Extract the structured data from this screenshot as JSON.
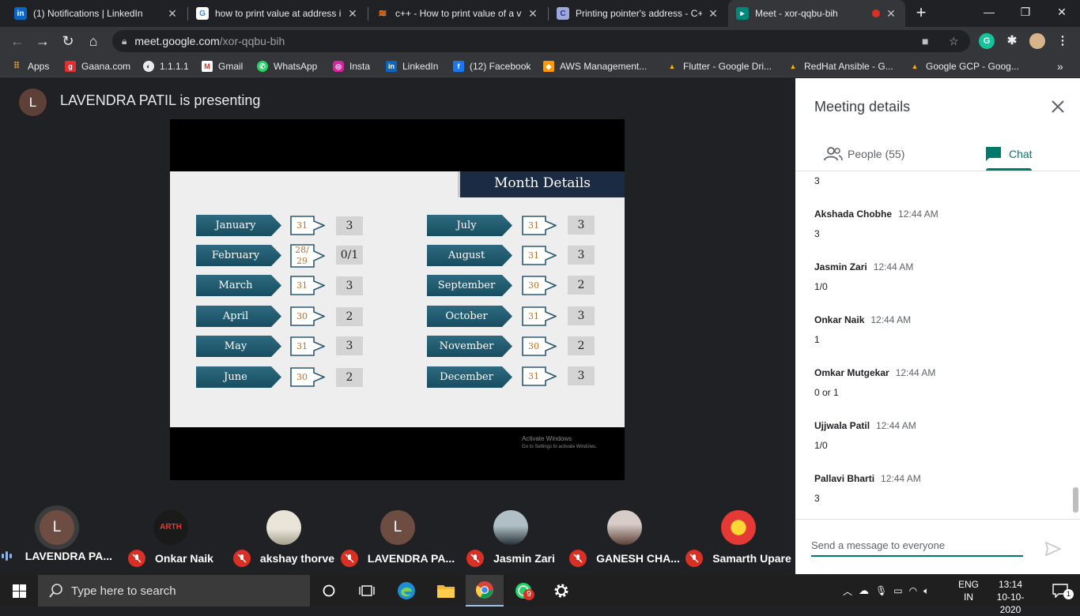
{
  "browser": {
    "tabs": [
      {
        "label": "(1) Notifications | LinkedIn",
        "icon": "linkedin-icon",
        "color": "#0a66c2"
      },
      {
        "label": "how to print value at address i",
        "icon": "google-icon",
        "color": "#ffffff"
      },
      {
        "label": "c++ - How to print value of a v",
        "icon": "stackoverflow-icon",
        "color": "#f48024"
      },
      {
        "label": "Printing pointer's address - C+",
        "icon": "cplusplus-icon",
        "color": "#9fa8da"
      },
      {
        "label": "Meet - xor-qqbu-bih",
        "icon": "meet-icon",
        "color": "#00897b"
      }
    ],
    "url_host": "meet.google.com",
    "url_path": "/xor-qqbu-bih",
    "bookmarks": [
      {
        "label": "Apps",
        "icon": "apps-grid-icon"
      },
      {
        "label": "Gaana.com",
        "icon": "gaana-icon"
      },
      {
        "label": "1.1.1.1",
        "icon": "globe-icon"
      },
      {
        "label": "Gmail",
        "icon": "gmail-icon"
      },
      {
        "label": "WhatsApp",
        "icon": "whatsapp-icon"
      },
      {
        "label": "Insta",
        "icon": "instagram-icon"
      },
      {
        "label": "LinkedIn",
        "icon": "linkedin-icon"
      },
      {
        "label": "(12) Facebook",
        "icon": "facebook-icon"
      },
      {
        "label": "AWS Management...",
        "icon": "aws-icon"
      },
      {
        "label": "Flutter - Google Dri...",
        "icon": "drive-icon"
      },
      {
        "label": "RedHat Ansible - G...",
        "icon": "drive-icon"
      },
      {
        "label": "Google GCP - Goog...",
        "icon": "drive-icon"
      }
    ]
  },
  "meet": {
    "presenter_initial": "L",
    "presenting_title": "LAVENDRA PATIL is presenting",
    "slide": {
      "title": "Month Details",
      "left": [
        {
          "month": "January",
          "days": "31",
          "value": "3"
        },
        {
          "month": "February",
          "days": "28/\n29",
          "value": "0/1"
        },
        {
          "month": "March",
          "days": "31",
          "value": "3"
        },
        {
          "month": "April",
          "days": "30",
          "value": "2"
        },
        {
          "month": "May",
          "days": "31",
          "value": "3"
        },
        {
          "month": "June",
          "days": "30",
          "value": "2"
        }
      ],
      "right": [
        {
          "month": "July",
          "days": "31",
          "value": "3"
        },
        {
          "month": "August",
          "days": "31",
          "value": "3"
        },
        {
          "month": "September",
          "days": "30",
          "value": "2"
        },
        {
          "month": "October",
          "days": "31",
          "value": "3"
        },
        {
          "month": "November",
          "days": "30",
          "value": "2"
        },
        {
          "month": "December",
          "days": "31",
          "value": "3"
        }
      ],
      "watermark_line1": "Activate Windows",
      "watermark_line2": "Go to Settings to activate Windows."
    },
    "participants": [
      {
        "name": "LAVENDRA PA...",
        "initial": "L",
        "speaking": true
      },
      {
        "name": "Onkar Naik",
        "initial": "ARTH",
        "speaking": false
      },
      {
        "name": "akshay thorve",
        "initial": "",
        "speaking": false
      },
      {
        "name": "LAVENDRA PA...",
        "initial": "L",
        "speaking": false
      },
      {
        "name": "Jasmin Zari",
        "initial": "",
        "speaking": false
      },
      {
        "name": "GANESH CHA...",
        "initial": "",
        "speaking": false
      },
      {
        "name": "Samarth Upare",
        "initial": "",
        "speaking": false
      }
    ],
    "panel": {
      "title": "Meeting details",
      "people_label": "People (55)",
      "chat_label": "Chat",
      "partial_message": "3",
      "messages": [
        {
          "sender": "Akshada Chobhe",
          "time": "12:44 AM",
          "text": "3"
        },
        {
          "sender": "Jasmin Zari",
          "time": "12:44 AM",
          "text": "1/0"
        },
        {
          "sender": "Onkar Naik",
          "time": "12:44 AM",
          "text": "1"
        },
        {
          "sender": "Omkar Mutgekar",
          "time": "12:44 AM",
          "text": "0 or 1"
        },
        {
          "sender": "Ujjwala Patil",
          "time": "12:44 AM",
          "text": "1/0"
        },
        {
          "sender": "Pallavi Bharti",
          "time": "12:44 AM",
          "text": "3"
        }
      ],
      "compose_placeholder": "Send a message to everyone"
    }
  },
  "taskbar": {
    "search_placeholder": "Type here to search",
    "whatsapp_badge": "9",
    "lang_line1": "ENG",
    "lang_line2": "IN",
    "time": "13:14",
    "date": "10-10-2020",
    "notification_count": "1"
  }
}
